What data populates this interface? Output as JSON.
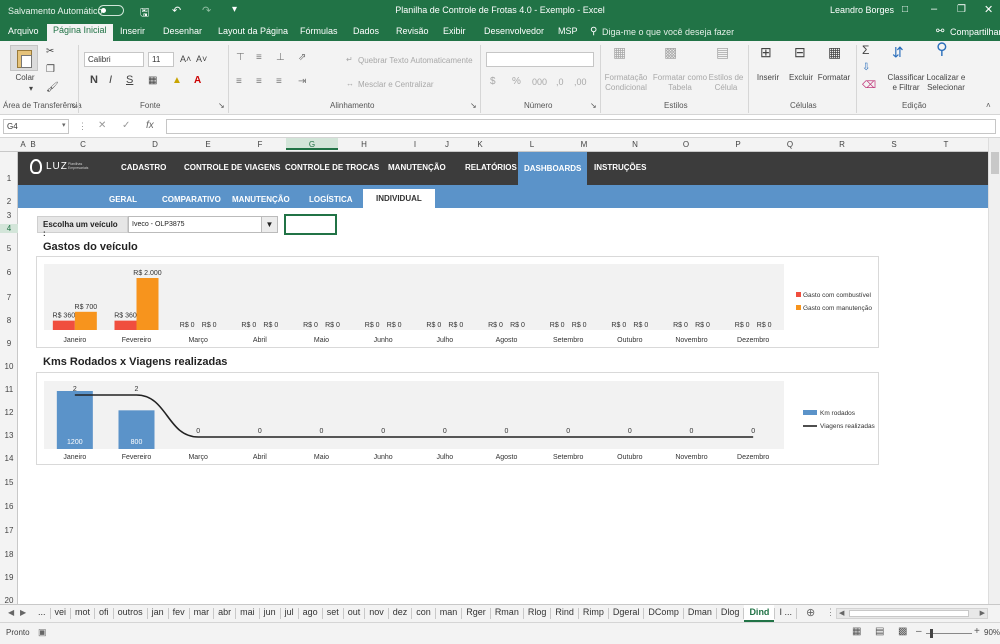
{
  "titlebar": {
    "autosave": "Salvamento Automático",
    "title": "Planilha de Controle de Frotas 4.0 - Exemplo  -  Excel",
    "user": "Leandro Borges"
  },
  "ribbon_tabs": [
    "Arquivo",
    "Página Inicial",
    "Inserir",
    "Desenhar",
    "Layout da Página",
    "Fórmulas",
    "Dados",
    "Revisão",
    "Exibir",
    "Desenvolvedor",
    "MSP"
  ],
  "tell_me": "Diga-me o que você deseja fazer",
  "share": "Compartilhar",
  "ribbon": {
    "paste": "Colar",
    "clipboard_group": "Área de Transferência",
    "font_name": "Calibri",
    "font_size": "11",
    "font_group": "Fonte",
    "wrap_text": "Quebrar Texto Automaticamente",
    "merge_center": "Mesclar e Centralizar",
    "alignment_group": "Alinhamento",
    "number_group": "Número",
    "cond_format_1": "Formatação",
    "cond_format_2": "Condicional",
    "format_table_1": "Formatar como",
    "format_table_2": "Tabela",
    "cell_styles_1": "Estilos de",
    "cell_styles_2": "Célula",
    "styles_group": "Estilos",
    "insert": "Inserir",
    "delete": "Excluir",
    "format": "Formatar",
    "cells_group": "Células",
    "sort_filter_1": "Classificar",
    "sort_filter_2": "e Filtrar",
    "find_select_1": "Localizar e",
    "find_select_2": "Selecionar",
    "editing_group": "Edição"
  },
  "formula_bar": {
    "name_box": "G4",
    "fx": "fx",
    "value": ""
  },
  "columns": [
    "A",
    "B",
    "C",
    "D",
    "E",
    "F",
    "G",
    "H",
    "I",
    "J",
    "K",
    "L",
    "M",
    "N",
    "O",
    "P",
    "Q",
    "R",
    "S",
    "T"
  ],
  "rows": [
    "1",
    "2",
    "3",
    "4",
    "5",
    "6",
    "7",
    "8",
    "9",
    "10",
    "11",
    "12",
    "13",
    "14",
    "15",
    "16",
    "17",
    "18",
    "19",
    "20"
  ],
  "dashboard": {
    "logo": "LUZ",
    "logo_sub": "Planilhas Empresariais",
    "nav": [
      "CADASTRO",
      "CONTROLE DE VIAGENS",
      "CONTROLE DE TROCAS",
      "MANUTENÇÃO",
      "RELATÓRIOS",
      "DASHBOARDS",
      "INSTRUÇÕES"
    ],
    "subnav": [
      "GERAL",
      "COMPARATIVO",
      "MANUTENÇÃO",
      "LOGÍSTICA",
      "INDIVIDUAL"
    ],
    "vehicle_label": "Escolha um veículo :",
    "vehicle_value": "Iveco - OLP3875",
    "chart1_title": "Gastos do veículo",
    "chart2_title": "Kms Rodados x Viagens realizadas"
  },
  "chart_data": [
    {
      "type": "bar",
      "title": "Gastos do veículo",
      "categories": [
        "Janeiro",
        "Fevereiro",
        "Março",
        "Abril",
        "Maio",
        "Junho",
        "Julho",
        "Agosto",
        "Setembro",
        "Outubro",
        "Novembro",
        "Dezembro"
      ],
      "series": [
        {
          "name": "Gasto com combustível",
          "color": "#f04e3e",
          "values": [
            360,
            360,
            0,
            0,
            0,
            0,
            0,
            0,
            0,
            0,
            0,
            0
          ],
          "labels": [
            "R$ 360",
            "R$ 360",
            "R$ 0",
            "R$ 0",
            "R$ 0",
            "R$ 0",
            "R$ 0",
            "R$ 0",
            "R$ 0",
            "R$ 0",
            "R$ 0",
            "R$ 0"
          ]
        },
        {
          "name": "Gasto com manutenção",
          "color": "#f7941d",
          "values": [
            700,
            2000,
            0,
            0,
            0,
            0,
            0,
            0,
            0,
            0,
            0,
            0
          ],
          "labels": [
            "R$ 700",
            "R$ 2.000",
            "R$ 0",
            "R$ 0",
            "R$ 0",
            "R$ 0",
            "R$ 0",
            "R$ 0",
            "R$ 0",
            "R$ 0",
            "R$ 0",
            "R$ 0"
          ]
        }
      ],
      "ylim": [
        0,
        2000
      ],
      "legend": "right"
    },
    {
      "type": "bar",
      "title": "Kms Rodados x Viagens realizadas",
      "categories": [
        "Janeiro",
        "Fevereiro",
        "Março",
        "Abril",
        "Maio",
        "Junho",
        "Julho",
        "Agosto",
        "Setembro",
        "Outubro",
        "Novembro",
        "Dezembro"
      ],
      "series": [
        {
          "name": "Km rodados",
          "kind": "bar",
          "color": "#5b93c9",
          "values": [
            1200,
            800,
            0,
            0,
            0,
            0,
            0,
            0,
            0,
            0,
            0,
            0
          ],
          "labels": [
            "1200",
            "800",
            "",
            "",
            "",
            "",
            "",
            "",
            "",
            "",
            "",
            ""
          ]
        },
        {
          "name": "Viagens realizadas",
          "kind": "line",
          "color": "#222222",
          "values": [
            2,
            2,
            0,
            0,
            0,
            0,
            0,
            0,
            0,
            0,
            0,
            0
          ],
          "labels": [
            "2",
            "2",
            "0",
            "0",
            "0",
            "0",
            "0",
            "0",
            "0",
            "0",
            "0",
            "0"
          ]
        }
      ],
      "legend": "right"
    }
  ],
  "sheet_tabs": [
    "...",
    "vei",
    "mot",
    "ofi",
    "outros",
    "jan",
    "fev",
    "mar",
    "abr",
    "mai",
    "jun",
    "jul",
    "ago",
    "set",
    "out",
    "nov",
    "dez",
    "con",
    "man",
    "Rger",
    "Rman",
    "Rlog",
    "Rind",
    "Rimp",
    "Dgeral",
    "DComp",
    "Dman",
    "Dlog",
    "Dind",
    "I ..."
  ],
  "active_sheet": "Dind",
  "status": {
    "ready": "Pronto",
    "zoom": "90%"
  }
}
